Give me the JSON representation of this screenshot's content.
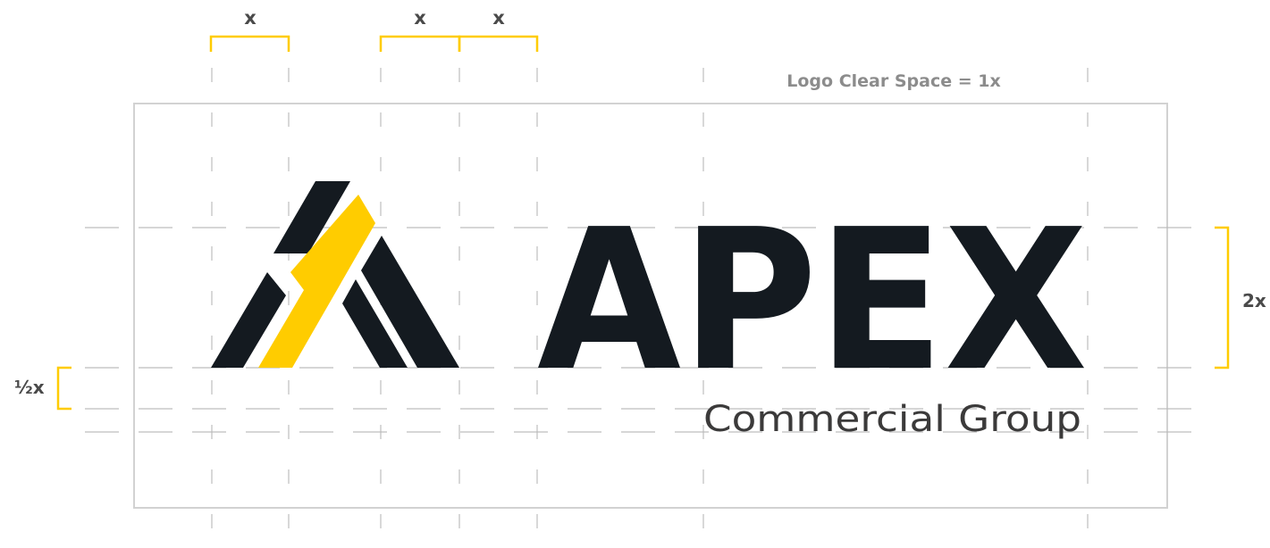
{
  "labels": {
    "x1": "x",
    "x2": "x",
    "x3": "x",
    "clear_space": "Logo Clear Space = 1x",
    "two_x": "2x",
    "half_x": "½x"
  },
  "logo": {
    "wordmark": "APEX",
    "tagline": "Commercial Group"
  },
  "colors": {
    "accent": "#FFCC00",
    "dark": "#141A20",
    "tagline": "#3B3A3A",
    "guide": "#BDBDBD",
    "label": "#4A4A4A",
    "caption": "#8C8C8C",
    "box": "#D2D2D2"
  }
}
